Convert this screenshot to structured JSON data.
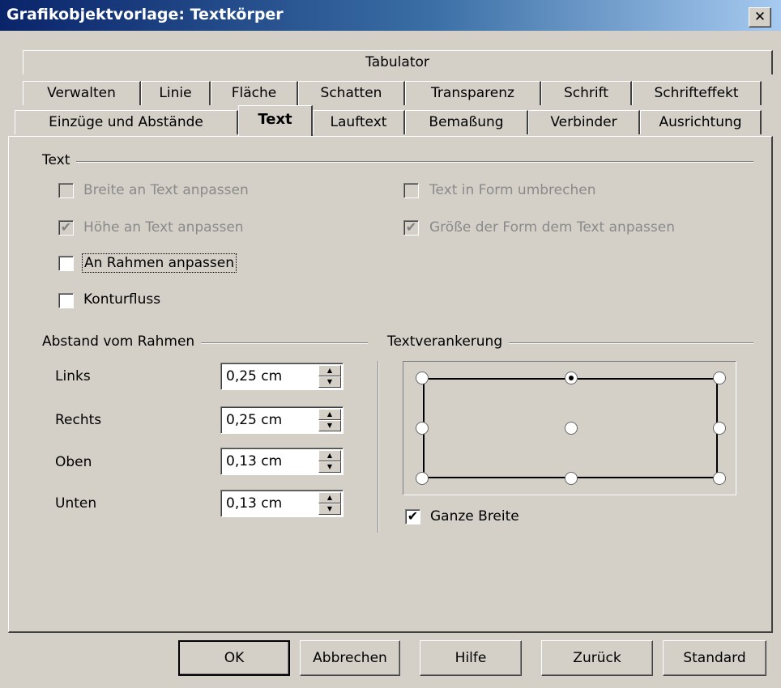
{
  "window": {
    "title": "Grafikobjektvorlage: Textkörper",
    "close_glyph": "✕"
  },
  "tabs": {
    "row1": [
      "Tabulator"
    ],
    "row2": [
      "Verwalten",
      "Linie",
      "Fläche",
      "Schatten",
      "Transparenz",
      "Schrift",
      "Schrifteffekt"
    ],
    "row3": [
      "Einzüge und Abstände",
      "Text",
      "Lauftext",
      "Bemaßung",
      "Verbinder",
      "Ausrichtung"
    ],
    "active": "Text"
  },
  "text_group": {
    "label": "Text",
    "options": {
      "breite": {
        "label": "Breite an Text anpassen",
        "checked": false,
        "enabled": false
      },
      "hoehe": {
        "label": "Höhe an Text anpassen",
        "checked": true,
        "enabled": false
      },
      "rahmen": {
        "label": "An Rahmen anpassen",
        "checked": false,
        "enabled": true
      },
      "kontur": {
        "label": "Konturfluss",
        "checked": false,
        "enabled": true
      },
      "umbrechen": {
        "label": "Text in Form umbrechen",
        "checked": false,
        "enabled": false
      },
      "groesse": {
        "label": "Größe der Form dem Text anpassen",
        "checked": true,
        "enabled": false
      }
    }
  },
  "abstand_group": {
    "label": "Abstand vom Rahmen",
    "links": {
      "label": "Links",
      "value": "0,25 cm"
    },
    "rechts": {
      "label": "Rechts",
      "value": "0,25 cm"
    },
    "oben": {
      "label": "Oben",
      "value": "0,13 cm"
    },
    "unten": {
      "label": "Unten",
      "value": "0,13 cm"
    }
  },
  "anker_group": {
    "label": "Textverankerung",
    "selected_anchor": "top-center",
    "ganze_breite": {
      "label": "Ganze Breite",
      "checked": true
    }
  },
  "buttons": {
    "ok": "OK",
    "abbrechen": "Abbrechen",
    "hilfe": "Hilfe",
    "zurueck": "Zurück",
    "standard": "Standard"
  },
  "glyphs": {
    "check": "✔",
    "up": "▲",
    "down": "▼"
  },
  "colors": {
    "dialog_bg": "#d4d0c8",
    "title_start": "#0a246a",
    "title_end": "#a6caf0",
    "disabled_text": "#8a8a8a"
  }
}
